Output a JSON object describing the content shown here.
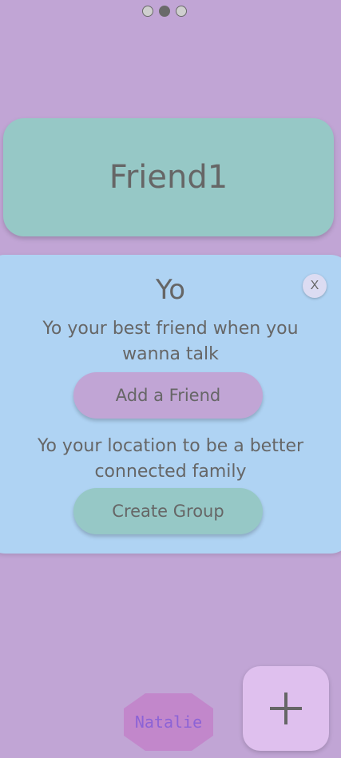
{
  "pager": {
    "page_count": 3,
    "active_index": 1
  },
  "friend_card": {
    "name": "Friend1"
  },
  "welcome_panel": {
    "title": "Yo",
    "close_label": "X",
    "friend_text": "Yo your best friend when you wanna talk",
    "add_friend_label": "Add a Friend",
    "location_text": "Yo your location to be a better connected family",
    "create_group_label": "Create Group"
  },
  "user": {
    "name": "Natalie"
  },
  "fab": {
    "icon": "plus-icon"
  },
  "colors": {
    "background": "#c1a5d5",
    "friend_card": "#96c8c6",
    "panel": "#afd3f3",
    "add_button": "#c1a5d5",
    "create_button": "#96c8c6",
    "avatar_hex": "#c287cb",
    "avatar_text": "#8c63d6",
    "fab": "#dfc0ee"
  }
}
